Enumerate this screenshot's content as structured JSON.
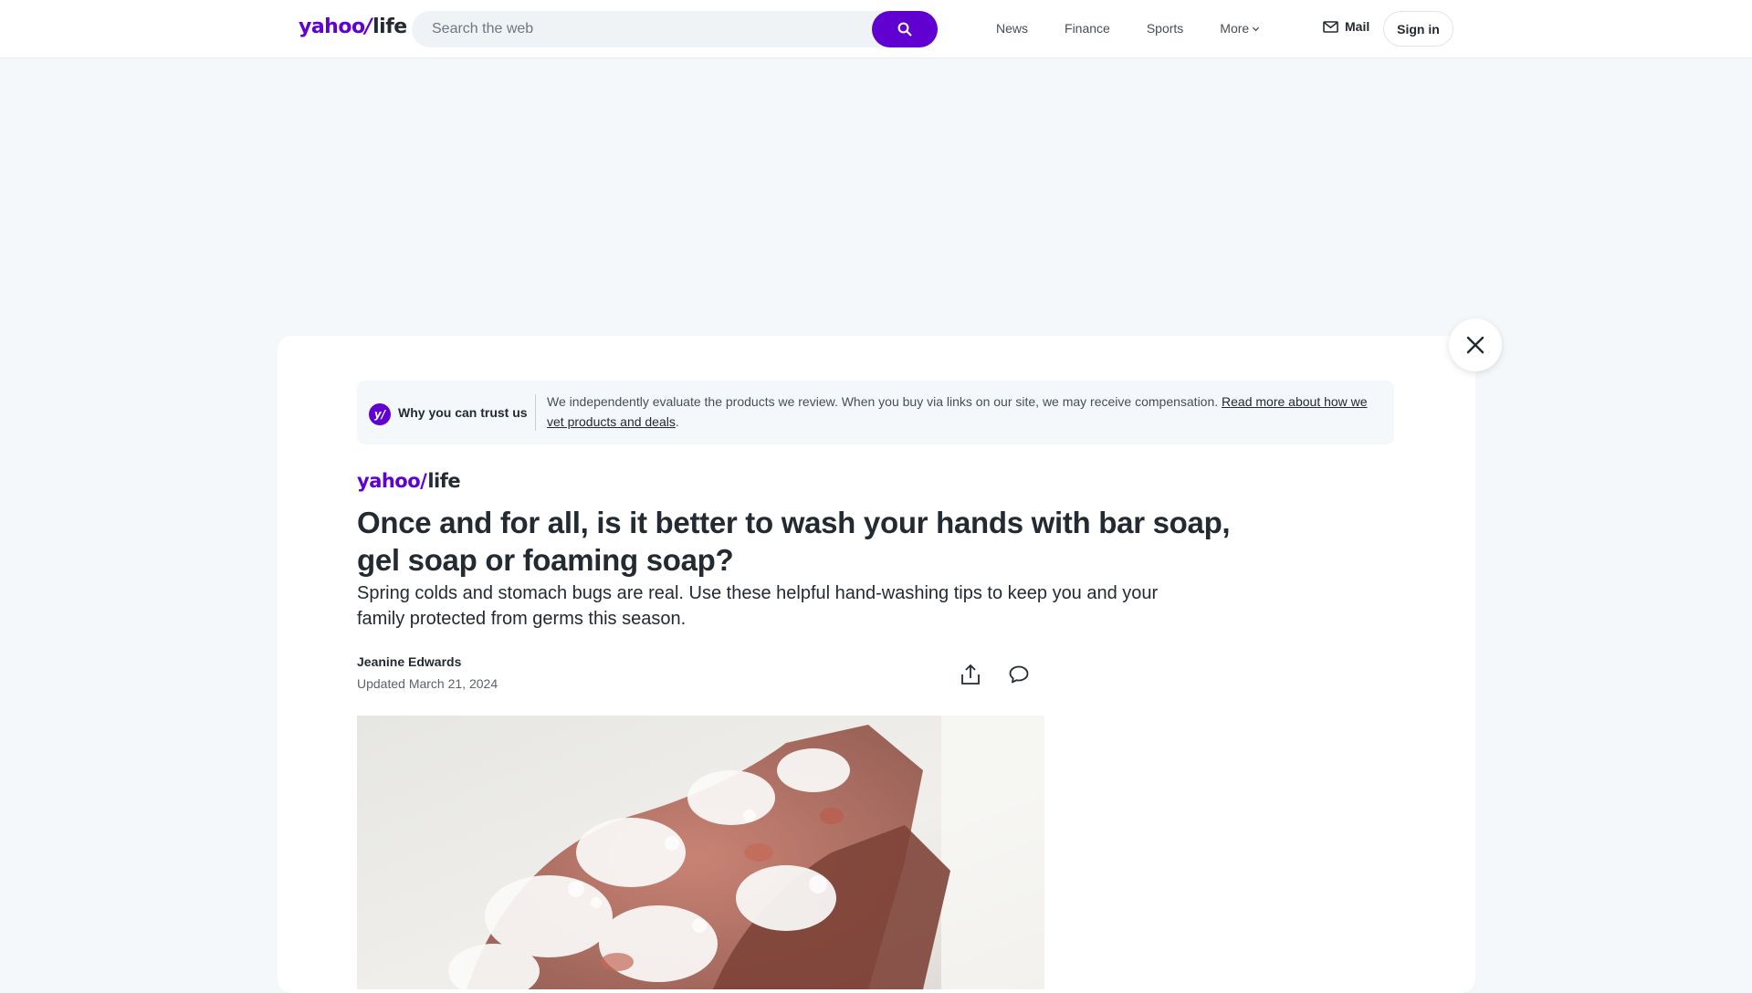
{
  "header": {
    "logo_text": "yahoo",
    "logo_slash": "/",
    "logo_section": "life",
    "search_placeholder": "Search the web",
    "nav": [
      {
        "label": "News"
      },
      {
        "label": "Finance"
      },
      {
        "label": "Sports"
      },
      {
        "label": "More"
      }
    ],
    "mail_label": "Mail",
    "signin_label": "Sign in"
  },
  "trust": {
    "badge": "y/",
    "title": "Why you can trust us",
    "text": "We independently evaluate the products we review. When you buy via links on our site, we may receive compensation. ",
    "link": "Read more about how we vet products and deals",
    "trailing": "."
  },
  "article": {
    "publisher_logo": "yahoo",
    "publisher_slash": "/",
    "publisher_section": "life",
    "headline": "Once and for all, is it better to wash your hands with bar soap, gel soap or foaming soap?",
    "subheadline": "Spring colds and stomach bugs are real. Use these helpful hand-washing tips to keep you and your family protected from germs this season.",
    "author": "Jeanine Edwards",
    "updated": "Updated March 21, 2024"
  },
  "icons": {
    "search": "search-icon",
    "mail": "mail-icon",
    "chevron": "chevron-down-icon",
    "close": "close-icon",
    "share": "share-icon",
    "comment": "comment-icon"
  },
  "colors": {
    "brand": "#6001d2",
    "page_bg": "#f5f8fa",
    "text": "#232a31"
  }
}
